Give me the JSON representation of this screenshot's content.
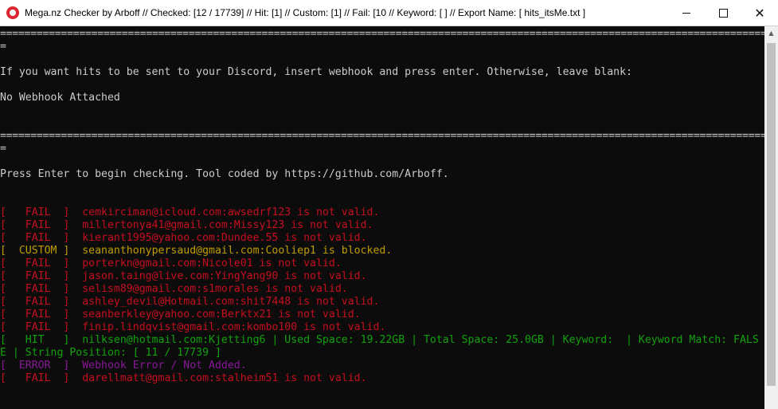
{
  "window": {
    "title": "Mega.nz Checker by Arboff // Checked: [12 / 17739] // Hit: [1] // Custom: [1] // Fail: [10 // Keyword: [  ] // Export Name: [ hits_itsMe.txt ]",
    "minimize_glyph": "",
    "maximize_glyph": "",
    "close_glyph": "✕"
  },
  "console": {
    "separator": "=============================================================================================================================================================",
    "separator_tail": "=",
    "webhook_prompt": "If you want hits to be sent to your Discord, insert webhook and press enter. Otherwise, leave blank:",
    "webhook_status": "No Webhook Attached",
    "start_prompt": "Press Enter to begin checking. Tool coded by https://github.com/Arboff.",
    "log": [
      {
        "status": "[   FAIL  ]",
        "message": "cemkirciman@icloud.com:awsedrf123 is not valid.",
        "color": "red"
      },
      {
        "status": "[   FAIL  ]",
        "message": "millertonya41@gmail.com:Missy123 is not valid.",
        "color": "red"
      },
      {
        "status": "[   FAIL  ]",
        "message": "kierant1995@yahoo.com:Dundee.55 is not valid.",
        "color": "red"
      },
      {
        "status": "[  CUSTOM ]",
        "message": "seananthonypersaud@gmail.com:Cooliep1 is blocked.",
        "color": "yellow"
      },
      {
        "status": "[   FAIL  ]",
        "message": "porterkn@gmail.com:Nicole01 is not valid.",
        "color": "red"
      },
      {
        "status": "[   FAIL  ]",
        "message": "jason.taing@live.com:YingYang90 is not valid.",
        "color": "red"
      },
      {
        "status": "[   FAIL  ]",
        "message": "selism89@gmail.com:s1morales is not valid.",
        "color": "red"
      },
      {
        "status": "[   FAIL  ]",
        "message": "ashley_devil@Hotmail.com:shit7448 is not valid.",
        "color": "red"
      },
      {
        "status": "[   FAIL  ]",
        "message": "seanberkley@yahoo.com:Berktx21 is not valid.",
        "color": "red"
      },
      {
        "status": "[   FAIL  ]",
        "message": "finip.lindqvist@gmail.com:kombo100 is not valid.",
        "color": "red"
      },
      {
        "status": "[   HIT   ]",
        "message": "nilksen@hotmail.com:Kjetting6 | Used Space: 19.22GB | Total Space: 25.0GB | Keyword:  | Keyword Match: FALS",
        "color": "green"
      },
      {
        "status": "",
        "message": "E | String Position: [ 11 / 17739 ]",
        "color": "green"
      },
      {
        "status": "[  ERROR  ]",
        "message": "Webhook Error / Not Added.",
        "color": "purple"
      },
      {
        "status": "[   FAIL  ]",
        "message": "darellmatt@gmail.com:stalheim51 is not valid.",
        "color": "red"
      }
    ]
  },
  "colors": {
    "background": "#0c0c0c",
    "text": "#cccccc",
    "fail": "#c50f1f",
    "custom": "#c19c00",
    "hit": "#13a10e",
    "error": "#881798"
  },
  "icons": {
    "app": "red-circle-app-icon",
    "scroll_up": "triangle-up-icon"
  }
}
